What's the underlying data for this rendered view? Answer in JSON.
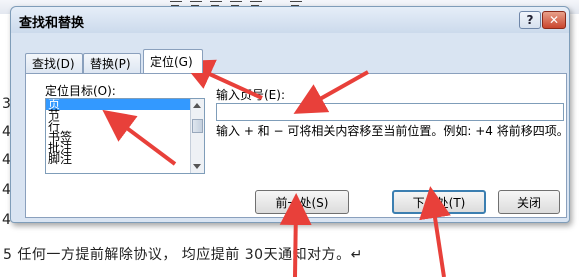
{
  "document": {
    "left_margin_chars": [
      "3",
      "4",
      "4",
      "4",
      "4"
    ],
    "bottom_line": "5 任何一方提前解除协议， 均应提前 30天通知对方。↵"
  },
  "dialog": {
    "title": "查找和替换",
    "help_label": "?",
    "close_label": "✕",
    "tabs": [
      {
        "label": "查找(D)",
        "active": false
      },
      {
        "label": "替换(P)",
        "active": false
      },
      {
        "label": "定位(G)",
        "active": true
      }
    ],
    "goto_target_label": "定位目标(O):",
    "goto_targets": [
      "页",
      "节",
      "行",
      "书签",
      "批注",
      "脚注"
    ],
    "selected_target": "页",
    "page_number_label": "输入页号(E):",
    "page_number_value": "",
    "hint": "输入 + 和 − 可将相关内容移至当前位置。例如: +4 将前移四项。",
    "buttons": {
      "previous": "前一处(S)",
      "next": "下一处(T)",
      "close": "关闭"
    }
  },
  "annotation": {
    "arrow_color": "#e8403a"
  }
}
